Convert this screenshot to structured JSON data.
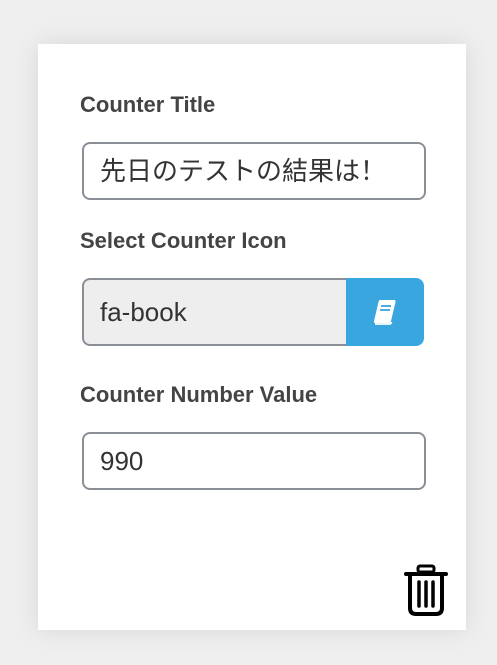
{
  "form": {
    "title_label": "Counter Title",
    "title_value": "先日のテストの結果は！",
    "icon_label": "Select Counter Icon",
    "icon_value": "fa-book",
    "icon_button_icon": "book-icon",
    "number_label": "Counter Number Value",
    "number_value": "990",
    "delete_icon": "trash-icon"
  },
  "colors": {
    "accent": "#3aa6e0",
    "label": "#444444",
    "border": "#8a8f96",
    "readonly_bg": "#eeeeee"
  }
}
